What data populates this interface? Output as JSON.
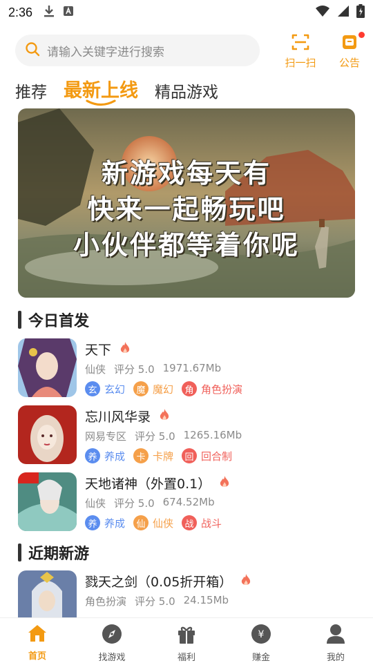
{
  "status_bar": {
    "time": "2:36",
    "icons": [
      "download-icon",
      "keyboard-icon",
      "wifi-icon",
      "signal-icon",
      "battery-icon"
    ]
  },
  "search": {
    "placeholder": "请输入关键字进行搜索"
  },
  "top_actions": {
    "scan_label": "扫一扫",
    "notice_label": "公告"
  },
  "tabs": [
    {
      "label": "推荐",
      "active": false
    },
    {
      "label": "最新上线",
      "active": true
    },
    {
      "label": "精品游戏",
      "active": false
    }
  ],
  "banner": {
    "lines": [
      "新游戏每天有",
      "快来一起畅玩吧",
      "小伙伴都等着你呢"
    ]
  },
  "sections": {
    "today": "今日首发",
    "recent": "近期新游"
  },
  "games": [
    {
      "name": "天下",
      "category": "仙侠",
      "rating": "评分 5.0",
      "size": "1971.67Mb",
      "tags": [
        {
          "badge": "玄",
          "label": "玄幻",
          "color": "#5b8def"
        },
        {
          "badge": "魔",
          "label": "魔幻",
          "color": "#f5a04a"
        },
        {
          "badge": "角",
          "label": "角色扮演",
          "color": "#f0605a"
        }
      ]
    },
    {
      "name": "忘川风华录",
      "category": "网易专区",
      "rating": "评分 5.0",
      "size": "1265.16Mb",
      "tags": [
        {
          "badge": "养",
          "label": "养成",
          "color": "#5b8def"
        },
        {
          "badge": "卡",
          "label": "卡牌",
          "color": "#f5a04a"
        },
        {
          "badge": "回",
          "label": "回合制",
          "color": "#f0605a"
        }
      ]
    },
    {
      "name": "天地诸神（外置0.1）",
      "category": "仙侠",
      "rating": "评分 5.0",
      "size": "674.52Mb",
      "tags": [
        {
          "badge": "养",
          "label": "养成",
          "color": "#5b8def"
        },
        {
          "badge": "仙",
          "label": "仙侠",
          "color": "#f5a04a"
        },
        {
          "badge": "战",
          "label": "战斗",
          "color": "#f0605a"
        }
      ]
    },
    {
      "name": "戮天之剑（0.05折开箱）",
      "category": "角色扮演",
      "rating": "评分 5.0",
      "size": "24.15Mb",
      "tags": []
    }
  ],
  "bottom_nav": [
    {
      "label": "首页",
      "icon": "home-icon",
      "active": true
    },
    {
      "label": "找游戏",
      "icon": "compass-icon",
      "active": false
    },
    {
      "label": "福利",
      "icon": "gift-icon",
      "active": false
    },
    {
      "label": "赚金",
      "icon": "money-bag-icon",
      "active": false
    },
    {
      "label": "我的",
      "icon": "user-icon",
      "active": false
    }
  ],
  "colors": {
    "accent": "#f39a12",
    "tag_blue": "#5b8def",
    "tag_orange": "#f5a04a",
    "tag_red": "#f0605a"
  }
}
